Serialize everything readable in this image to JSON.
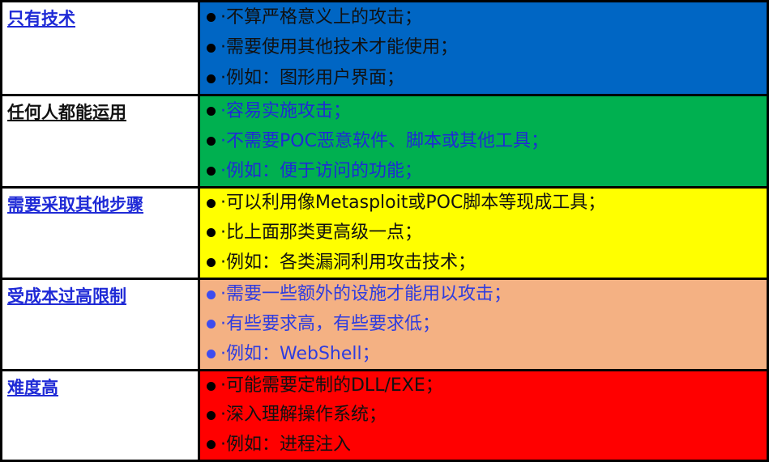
{
  "colors": {
    "row1_bg": "#0066c4",
    "row2_bg": "#00b050",
    "row3_bg": "#ffff00",
    "row4_bg": "#f4b183",
    "row5_bg": "#ff0000",
    "row1_text": "#111111",
    "row2_text": "#1f2ad6",
    "row3_text": "#111111",
    "row4_text": "#2e3ce0",
    "row5_text": "#111111",
    "dot_dark": "#000000",
    "dot_blue": "#3d4cf0"
  },
  "rows": [
    {
      "label": "只有技术",
      "items": [
        "·不算严格意义上的攻击；",
        "·需要使用其他技术才能使用；",
        "·例如：图形用户界面；"
      ]
    },
    {
      "label": "任何人都能运用",
      "items": [
        "·容易实施攻击；",
        "·不需要POC恶意软件、脚本或其他工具；",
        "·例如：便于访问的功能；"
      ]
    },
    {
      "label": "需要采取其他步骤",
      "items": [
        "·可以利用像Metasploit或POC脚本等现成工具；",
        "·比上面那类更高级一点；",
        "·例如：各类漏洞利用攻击技术；"
      ]
    },
    {
      "label": "受成本过高限制",
      "items": [
        "·需要一些额外的设施才能用以攻击；",
        "·有些要求高，有些要求低；",
        "·例如：WebShell；"
      ]
    },
    {
      "label": "难度高",
      "items": [
        "·可能需要定制的DLL/EXE；",
        "·深入理解操作系统；",
        "·例如：进程注入"
      ]
    }
  ]
}
